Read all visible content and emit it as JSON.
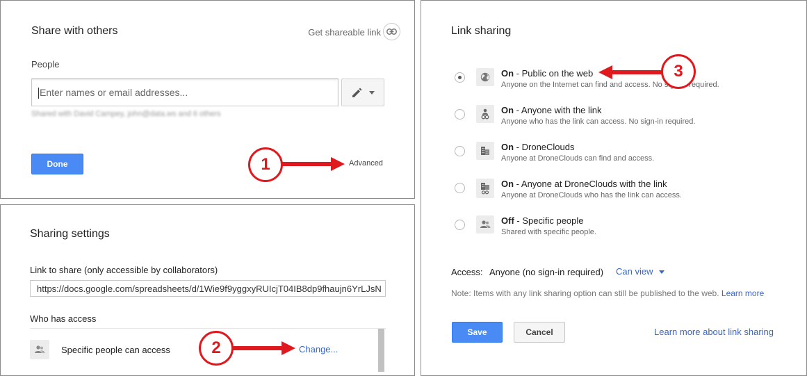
{
  "share_dialog": {
    "title": "Share with others",
    "get_link_label": "Get shareable link",
    "people_label": "People",
    "input_placeholder": "Enter names or email addresses...",
    "shared_with_text": "Shared with David Campey, john@data.ws and 6 others",
    "done_label": "Done",
    "advanced_label": "Advanced",
    "callout_number": "1"
  },
  "sharing_settings": {
    "title": "Sharing settings",
    "link_label": "Link to share (only accessible by collaborators)",
    "link_url": "https://docs.google.com/spreadsheets/d/1Wie9f9yggxyRUIcjT04IB8dp9fhaujn6YrLJsN",
    "who_has_access_label": "Who has access",
    "access_text": "Specific people can access",
    "change_label": "Change...",
    "callout_number": "2"
  },
  "link_sharing": {
    "title": "Link sharing",
    "callout_number": "3",
    "options": [
      {
        "state": "On",
        "title": " - Public on the web",
        "desc": "Anyone on the Internet can find and access. No sign-in required.",
        "selected": true,
        "icon": "globe-icon"
      },
      {
        "state": "On",
        "title": " - Anyone with the link",
        "desc": "Anyone who has the link can access. No sign-in required.",
        "selected": false,
        "icon": "person-link-icon"
      },
      {
        "state": "On",
        "title": " - DroneClouds",
        "desc": "Anyone at DroneClouds can find and access.",
        "selected": false,
        "icon": "building-icon"
      },
      {
        "state": "On",
        "title": " - Anyone at DroneClouds with the link",
        "desc": "Anyone at DroneClouds who has the link can access.",
        "selected": false,
        "icon": "building-link-icon"
      },
      {
        "state": "Off",
        "title": " - Specific people",
        "desc": "Shared with specific people.",
        "selected": false,
        "icon": "people-icon"
      }
    ],
    "access_label": "Access:",
    "access_value": "Anyone (no sign-in required)",
    "can_view_label": "Can view",
    "note_text": "Note: Items with any link sharing option can still be published to the web.",
    "learn_more_label": "Learn more",
    "save_label": "Save",
    "cancel_label": "Cancel",
    "learn_more_sharing_label": "Learn more about link sharing"
  },
  "colors": {
    "accent_blue": "#4a8af4",
    "link_blue": "#3c66c4",
    "callout_red": "#e0191f"
  }
}
